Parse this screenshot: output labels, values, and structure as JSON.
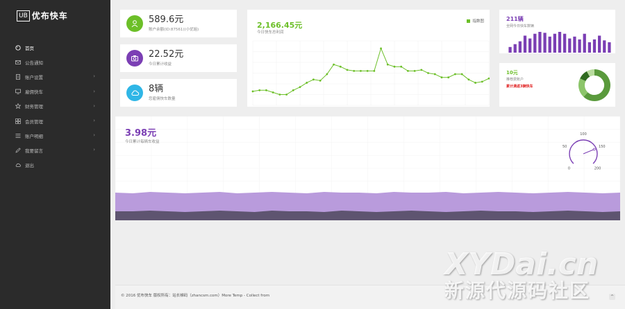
{
  "sidebar": {
    "brand_badge": "UB",
    "brand_name": "优布快车",
    "items": [
      {
        "label": "首页",
        "icon": "palette-icon",
        "has_caret": false,
        "active": true
      },
      {
        "label": "公告通知",
        "icon": "envelope-icon",
        "has_caret": false,
        "active": false
      },
      {
        "label": "账户设置",
        "icon": "document-icon",
        "has_caret": true,
        "active": false
      },
      {
        "label": "雇佣快车",
        "icon": "monitor-icon",
        "has_caret": true,
        "active": false
      },
      {
        "label": "财务管理",
        "icon": "star-icon",
        "has_caret": true,
        "active": false
      },
      {
        "label": "会员管理",
        "icon": "grid-icon",
        "has_caret": true,
        "active": false
      },
      {
        "label": "账户明细",
        "icon": "list-icon",
        "has_caret": true,
        "active": false
      },
      {
        "label": "我要留言",
        "icon": "pencil-icon",
        "has_caret": true,
        "active": false
      },
      {
        "label": "退出",
        "icon": "cloud-icon",
        "has_caret": false,
        "active": false
      }
    ]
  },
  "stats": [
    {
      "value": "589.6元",
      "label": "账户余额(ID:87561)(小优姐)",
      "icon": "user-icon",
      "color": "#6cbf28"
    },
    {
      "value": "22.52元",
      "label": "今日累计收益",
      "icon": "camera-icon",
      "color": "#7b3fb4"
    },
    {
      "value": "8辆",
      "label": "您雇佣快车数量",
      "icon": "cloud-icon",
      "color": "#2fb6e6"
    }
  ],
  "line_card": {
    "value": "2,166.45元",
    "label": "今日快车总利润",
    "legend": "指数图",
    "color": "#6cbf28"
  },
  "bar_card": {
    "value": "211辆",
    "label": "全网今日快车数辆",
    "color": "#7b3fb4"
  },
  "donut_card": {
    "value": "10元",
    "label": "推荐费账户",
    "alert": "累计满返3辆快车",
    "alert_color": "#e02020"
  },
  "area_card": {
    "value": "3.98元",
    "label": "今日累计每辆车收益",
    "gauge_labels": [
      "0",
      "50",
      "100",
      "150",
      "200"
    ],
    "gauge_value": 150
  },
  "footer": {
    "text": "© 2016 优布快车 版权所有：站长梯码（zhancsm.com）More Temp - Collect from",
    "scroll_top": "^"
  },
  "watermark": {
    "line1": "XYDai.cn",
    "line2": "新源代源码社区"
  },
  "chart_data": [
    {
      "type": "line",
      "title": "2,166.45元",
      "series": [
        {
          "name": "指数图",
          "values": [
            13,
            14,
            14,
            12,
            10,
            10,
            14,
            17,
            21,
            24,
            23,
            29,
            38,
            36,
            33,
            32,
            32,
            32,
            32,
            53,
            38,
            36,
            36,
            32,
            32,
            33,
            30,
            29,
            26,
            26,
            29,
            29,
            24,
            21,
            22,
            25
          ]
        }
      ],
      "color": "#6cbf28",
      "grid": true,
      "legend": "top-right"
    },
    {
      "type": "bar",
      "title": "211辆",
      "values": [
        6,
        9,
        12,
        18,
        15,
        20,
        22,
        21,
        17,
        20,
        22,
        20,
        15,
        17,
        14,
        20,
        11,
        14,
        18,
        13,
        11
      ],
      "color": "#7b3fb4"
    },
    {
      "type": "pie",
      "title": "10元",
      "values": [
        62,
        20,
        10,
        8
      ],
      "colors": [
        "#5a9a3c",
        "#8cc56a",
        "#2f6b1f",
        "#b9dc9e"
      ]
    },
    {
      "type": "area",
      "title": "3.98元",
      "series": [
        {
          "values": [
            40,
            39,
            41,
            40,
            39,
            40,
            41,
            39,
            40,
            41,
            40,
            39,
            41,
            40,
            40,
            39,
            41,
            40,
            40,
            41,
            39,
            40,
            41,
            40,
            39,
            40,
            41,
            40,
            39,
            40
          ]
        },
        {
          "values": [
            13,
            13,
            14,
            13,
            12,
            13,
            14,
            13,
            12,
            14,
            13,
            13,
            12,
            14,
            13,
            12,
            13,
            14,
            13,
            12,
            13,
            14,
            13,
            13,
            12,
            13,
            14,
            13,
            12,
            13
          ]
        }
      ],
      "colors": [
        "#b99bdc",
        "#5e5470"
      ]
    }
  ]
}
